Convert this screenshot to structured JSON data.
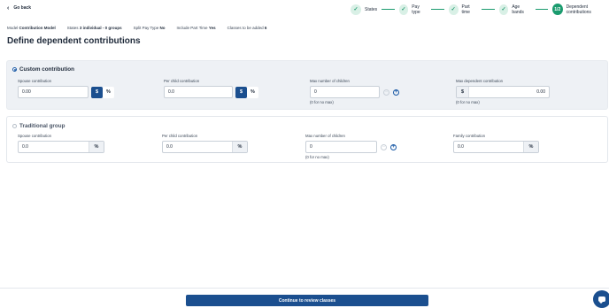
{
  "nav": {
    "go_back": "Go back"
  },
  "stepper": {
    "steps": [
      {
        "label": "States",
        "icon": "check-icon"
      },
      {
        "label": "Pay type",
        "icon": "check-icon"
      },
      {
        "label": "Part time",
        "icon": "check-icon"
      },
      {
        "label": "Age bands",
        "icon": "check-icon"
      },
      {
        "label": "Dependent contributions",
        "badge": "1/2"
      }
    ]
  },
  "meta": {
    "model_label": "Model",
    "model_value": "Contribution Model",
    "states_label": "States",
    "states_value": "3 individual - 0 groups",
    "split_label": "Split Pay Type",
    "split_value": "No",
    "parttime_label": "Include Part Time",
    "parttime_value": "Yes",
    "classes_label": "Classes to be added",
    "classes_value": "6"
  },
  "page_title": "Define dependent contributions",
  "custom": {
    "title": "Custom contribution",
    "selected": true,
    "spouse_label": "Spouse contribution",
    "spouse_value": "0.00",
    "per_child_label": "Per child contribution",
    "per_child_value": "0.0",
    "max_children_label": "Max number of children",
    "max_children_value": "0",
    "max_children_hint": "(0 for no max)",
    "max_dependent_label": "Max dependent contribution",
    "max_dependent_value": "0.00",
    "max_dependent_hint": "(0 for no max)",
    "dollar_symbol": "$",
    "percent_symbol": "%"
  },
  "traditional": {
    "title": "Traditional group",
    "selected": false,
    "spouse_label": "Spouse contribution",
    "spouse_value": "0.0",
    "per_child_label": "Per child contribution",
    "per_child_value": "0.0",
    "max_children_label": "Max number of children",
    "max_children_value": "0",
    "max_children_hint": "(0 for no max)",
    "family_label": "Family contribution",
    "family_value": "0.0",
    "percent_symbol": "%"
  },
  "stepper_controls": {
    "minus": "−",
    "plus": "+"
  },
  "footer": {
    "cta": "Continue to review classes"
  },
  "colors": {
    "primary": "#1b4f8f",
    "success": "#1a9b6e",
    "panel": "#eef1f5"
  }
}
